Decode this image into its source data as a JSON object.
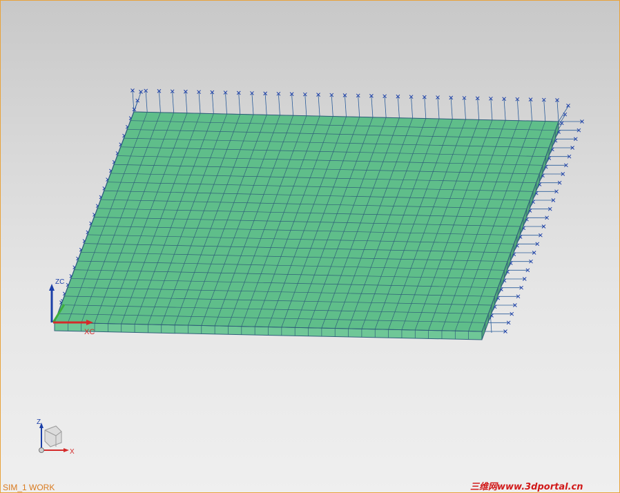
{
  "viewport": {
    "status_label": "SIM_1 WORK",
    "watermark": "三维网www.3dportal.cn"
  },
  "axes": {
    "work_x": "XC",
    "work_z": "ZC",
    "triad_x": "X",
    "triad_z": "Z"
  },
  "mesh": {
    "columns": 32,
    "rows": 24,
    "face_color": "#5fbe8a",
    "line_color": "#2f5f7a",
    "constraint_color": "#2a5c9a"
  },
  "colors": {
    "frame": "#e8a23a",
    "x_axis": "#d42a2a",
    "y_axis": "#3cae3c",
    "z_axis": "#1b3fa8"
  }
}
